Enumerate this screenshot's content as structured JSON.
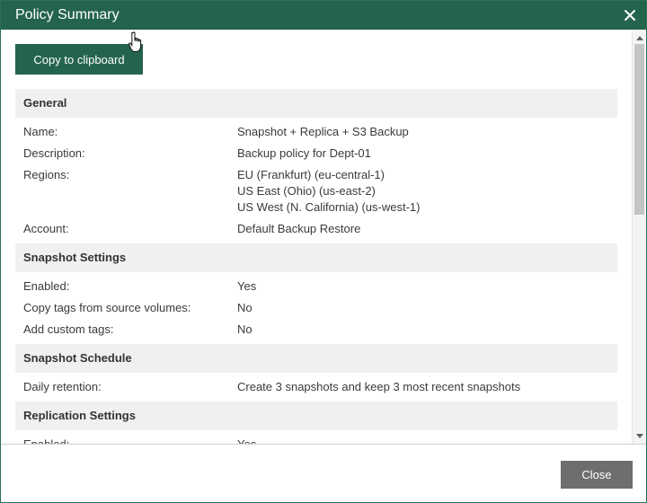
{
  "window": {
    "title": "Policy Summary"
  },
  "toolbar": {
    "copy_label": "Copy to clipboard"
  },
  "sections": [
    {
      "title": "General",
      "rows": [
        {
          "label": "Name:",
          "values": [
            "Snapshot + Replica + S3 Backup"
          ]
        },
        {
          "label": "Description:",
          "values": [
            "Backup policy for Dept-01"
          ]
        },
        {
          "label": "Regions:",
          "values": [
            "EU (Frankfurt) (eu-central-1)",
            "US East (Ohio) (us-east-2)",
            "US West (N. California) (us-west-1)"
          ]
        },
        {
          "label": "Account:",
          "values": [
            "Default Backup Restore"
          ]
        }
      ]
    },
    {
      "title": "Snapshot Settings",
      "rows": [
        {
          "label": "Enabled:",
          "values": [
            "Yes"
          ]
        },
        {
          "label": "Copy tags from source volumes:",
          "values": [
            "No"
          ]
        },
        {
          "label": "Add custom tags:",
          "values": [
            "No"
          ]
        }
      ]
    },
    {
      "title": "Snapshot Schedule",
      "rows": [
        {
          "label": "Daily retention:",
          "values": [
            "Create 3 snapshots and keep 3 most recent snapshots"
          ]
        }
      ]
    },
    {
      "title": "Replication Settings",
      "rows": [
        {
          "label": "Enabled:",
          "values": [
            "Yes"
          ]
        }
      ]
    }
  ],
  "footer": {
    "close_label": "Close"
  },
  "colors": {
    "titlebar": "#24644d",
    "primary_button": "#24644d",
    "close_button": "#6e6e6e",
    "section_header_bg": "#f0f0f0"
  },
  "icons": {
    "window_close": "close-icon",
    "cursor": "hand-cursor-icon",
    "scroll_up": "arrow-up-icon",
    "scroll_down": "arrow-down-icon"
  }
}
